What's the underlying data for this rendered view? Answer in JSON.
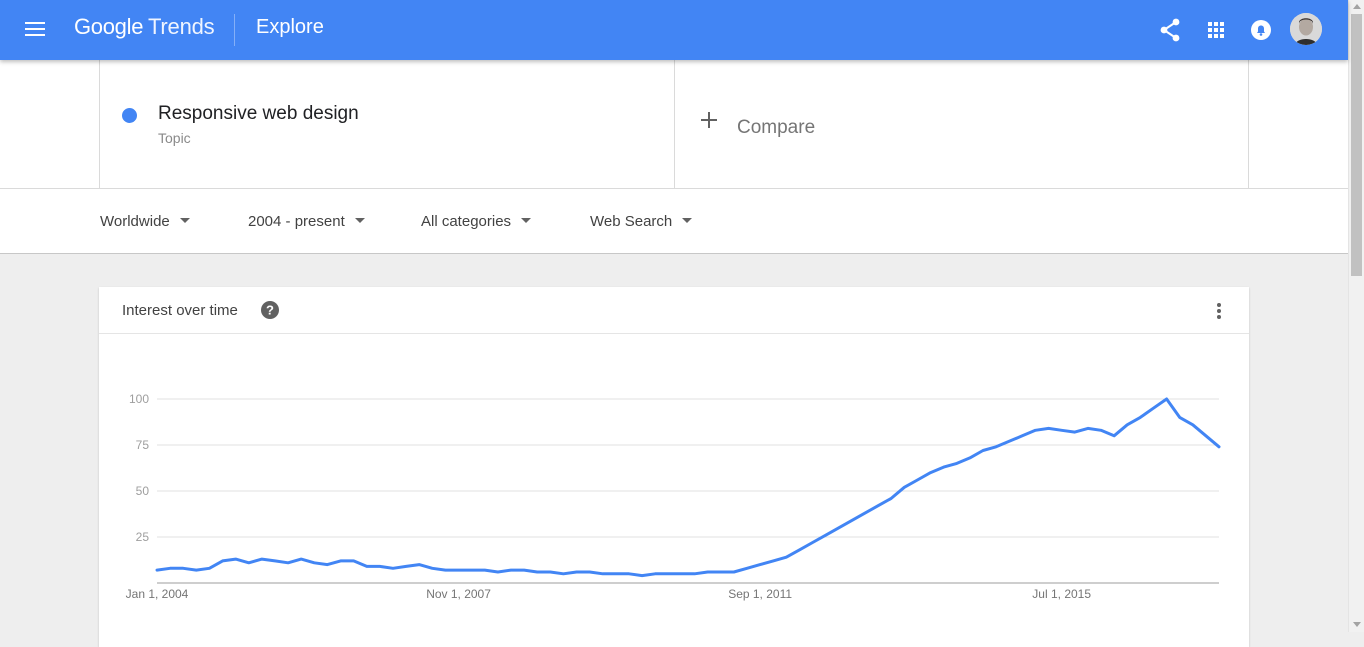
{
  "header": {
    "logo_google": "Google",
    "logo_trends": "Trends",
    "title": "Explore",
    "icons": [
      "menu-icon",
      "share-icon",
      "apps-icon",
      "notifications-icon"
    ],
    "accent_color": "#4285f4"
  },
  "search": {
    "term": {
      "name": "Responsive web design",
      "type": "Topic",
      "color": "#4285f4"
    },
    "compare_label": "Compare"
  },
  "filters": {
    "geo": "Worldwide",
    "time": "2004 - present",
    "category": "All categories",
    "property": "Web Search"
  },
  "card": {
    "title": "Interest over time"
  },
  "chart_data": {
    "type": "line",
    "title": "Interest over time",
    "xlabel": "",
    "ylabel": "",
    "ylim": [
      0,
      100
    ],
    "yticks": [
      25,
      50,
      75,
      100
    ],
    "x_tick_labels": [
      "Jan 1, 2004",
      "Nov 1, 2007",
      "Sep 1, 2011",
      "Jul 1, 2015"
    ],
    "grid": true,
    "legend": "none",
    "series": [
      {
        "color": "#4285f4",
        "x": [
          "2004-01",
          "2004-03",
          "2004-05",
          "2004-07",
          "2004-09",
          "2004-11",
          "2005-01",
          "2005-03",
          "2005-05",
          "2005-07",
          "2005-09",
          "2005-11",
          "2006-01",
          "2006-03",
          "2006-05",
          "2006-07",
          "2006-09",
          "2006-11",
          "2007-01",
          "2007-03",
          "2007-05",
          "2007-07",
          "2007-09",
          "2007-11",
          "2008-01",
          "2008-03",
          "2008-05",
          "2008-07",
          "2008-09",
          "2008-11",
          "2009-01",
          "2009-03",
          "2009-05",
          "2009-07",
          "2009-09",
          "2009-11",
          "2010-01",
          "2010-03",
          "2010-05",
          "2010-07",
          "2010-09",
          "2010-11",
          "2011-01",
          "2011-03",
          "2011-05",
          "2011-07",
          "2011-09",
          "2011-11",
          "2012-01",
          "2012-03",
          "2012-05",
          "2012-07",
          "2012-09",
          "2012-11",
          "2013-01",
          "2013-03",
          "2013-05",
          "2013-07",
          "2013-09",
          "2013-11",
          "2014-01",
          "2014-03",
          "2014-05",
          "2014-07",
          "2014-09",
          "2014-11",
          "2015-01",
          "2015-03",
          "2015-05",
          "2015-07",
          "2015-09",
          "2015-11",
          "2016-01",
          "2016-03",
          "2016-05",
          "2016-07",
          "2016-09",
          "2016-11",
          "2017-01",
          "2017-03",
          "2017-05",
          "2017-07"
        ],
        "values": [
          7,
          8,
          8,
          7,
          8,
          12,
          13,
          11,
          13,
          12,
          11,
          13,
          11,
          10,
          12,
          12,
          9,
          9,
          8,
          9,
          10,
          8,
          7,
          7,
          7,
          7,
          6,
          7,
          7,
          6,
          6,
          5,
          6,
          6,
          5,
          5,
          5,
          4,
          5,
          5,
          5,
          5,
          6,
          6,
          6,
          8,
          10,
          12,
          14,
          18,
          22,
          26,
          30,
          34,
          38,
          42,
          46,
          52,
          56,
          60,
          63,
          65,
          68,
          72,
          74,
          77,
          80,
          83,
          84,
          83,
          82,
          84,
          83,
          80,
          86,
          90,
          95,
          100,
          90,
          86,
          80,
          74
        ]
      }
    ]
  }
}
